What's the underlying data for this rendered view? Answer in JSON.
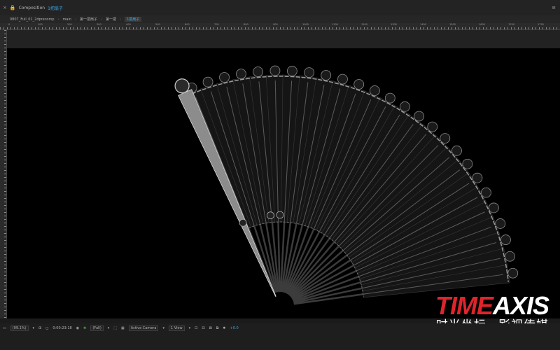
{
  "titlebar": {
    "panel_label": "Composition",
    "comp_name": "1把扇子"
  },
  "breadcrumbs": [
    "0807_Full_01_2dprecomp",
    "main",
    "第一把扇子",
    "第一把",
    "1把扇子"
  ],
  "ruler": {
    "ticks": [
      "0",
      "100",
      "200",
      "300",
      "400",
      "500",
      "600",
      "700",
      "800",
      "900",
      "1000",
      "1100",
      "1200",
      "1300",
      "1400",
      "1500",
      "1600",
      "1700",
      "1750"
    ]
  },
  "watermark": {
    "brand_red": "TIME",
    "brand_white": "AXIS",
    "chinese_left": "时光坐标",
    "chinese_right": "影视传媒"
  },
  "statusbar": {
    "zoom": "(99.1%)",
    "timecode": "0:00:23:18",
    "resolution": "(Full)",
    "camera": "Active Camera",
    "views": "1 View",
    "exposure": "+0.0"
  },
  "colors": {
    "accent_blue": "#3aa6e6",
    "brand_red": "#e0242c",
    "active_green": "#4cc34c"
  },
  "icons": [
    "lock-icon",
    "menu-icon",
    "camera-icon",
    "grid-icon",
    "color-wheel-icon",
    "dropdown-icon",
    "exposure-icon"
  ]
}
